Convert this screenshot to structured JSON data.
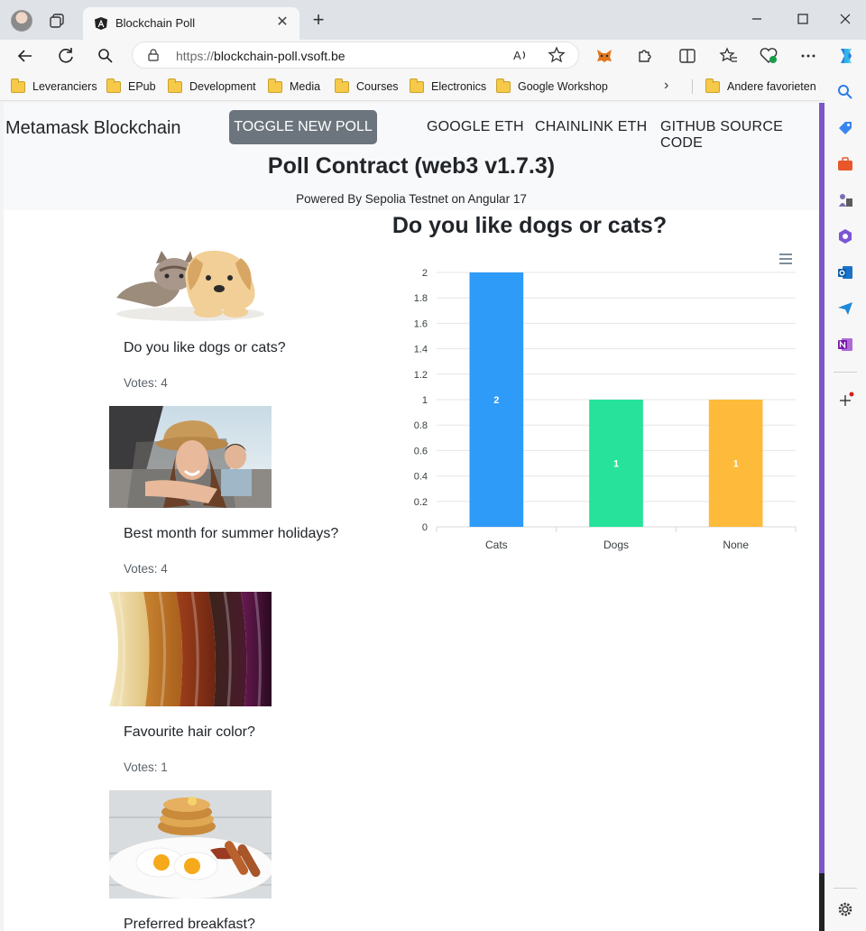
{
  "browser": {
    "tab_title": "Blockchain Poll",
    "url_protocol": "https://",
    "url_host": "blockchain-poll.vsoft.be",
    "bookmarks": [
      "Leveranciers",
      "EPub",
      "Development",
      "Media",
      "Courses",
      "Electronics",
      "Google Workshop",
      "Andere favorieten"
    ]
  },
  "navbar": {
    "brand": "Metamask Blockchain",
    "toggle_label": "TOGGLE NEW POLL",
    "links": [
      "GOOGLE ETH",
      "CHAINLINK ETH",
      "GITHUB SOURCE CODE"
    ]
  },
  "header": {
    "title": "Poll Contract (web3 v1.7.3)",
    "subtitle": "Powered By Sepolia Testnet on Angular 17"
  },
  "polls": [
    {
      "question": "Do you like dogs or cats?",
      "votes": "Votes: 4"
    },
    {
      "question": "Best month for summer holidays?",
      "votes": "Votes: 4"
    },
    {
      "question": "Favourite hair color?",
      "votes": "Votes: 1"
    },
    {
      "question": "Preferred breakfast?",
      "votes": ""
    }
  ],
  "chart_data": {
    "type": "bar",
    "title": "Do you like dogs or cats?",
    "categories": [
      "Cats",
      "Dogs",
      "None"
    ],
    "values": [
      2,
      1,
      1
    ],
    "colors": [
      "#2e9bf8",
      "#26e29a",
      "#feba3b"
    ],
    "ylim": [
      0,
      2
    ],
    "yticks": [
      "0",
      "0.2",
      "0.4",
      "0.6",
      "0.8",
      "1",
      "1.2",
      "1.4",
      "1.6",
      "1.8",
      "2"
    ],
    "grid": true,
    "data_labels": true,
    "xlabel": "",
    "ylabel": ""
  }
}
